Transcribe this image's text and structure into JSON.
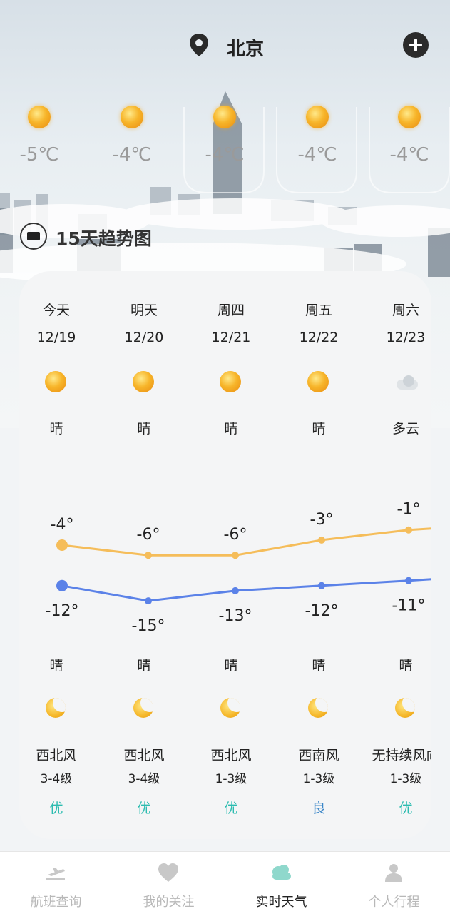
{
  "header": {
    "city": "北京",
    "location_icon": "map-pin-icon",
    "add_icon": "plus-icon"
  },
  "hourly": [
    {
      "icon": "sun-icon",
      "temp": "-5℃"
    },
    {
      "icon": "sun-icon",
      "temp": "-4℃"
    },
    {
      "icon": "sun-icon",
      "temp": "-4℃"
    },
    {
      "icon": "sun-icon",
      "temp": "-4℃"
    },
    {
      "icon": "sun-icon",
      "temp": "-4℃"
    }
  ],
  "trend": {
    "title": "15天趋势图",
    "icon": "briefcase-icon"
  },
  "forecast": [
    {
      "day": "今天",
      "date": "12/19",
      "day_icon": "sun-icon",
      "day_cond": "晴",
      "high": -4,
      "low": -12,
      "high_label": "-4°",
      "low_label": "-12°",
      "night_cond": "晴",
      "night_icon": "moon-icon",
      "wind_dir": "西北风",
      "wind_level": "3-4级",
      "aqi": "优",
      "aqi_color": "#2cbcb0"
    },
    {
      "day": "明天",
      "date": "12/20",
      "day_icon": "sun-icon",
      "day_cond": "晴",
      "high": -6,
      "low": -15,
      "high_label": "-6°",
      "low_label": "-15°",
      "night_cond": "晴",
      "night_icon": "moon-icon",
      "wind_dir": "西北风",
      "wind_level": "3-4级",
      "aqi": "优",
      "aqi_color": "#2cbcb0"
    },
    {
      "day": "周四",
      "date": "12/21",
      "day_icon": "sun-icon",
      "day_cond": "晴",
      "high": -6,
      "low": -13,
      "high_label": "-6°",
      "low_label": "-13°",
      "night_cond": "晴",
      "night_icon": "moon-icon",
      "wind_dir": "西北风",
      "wind_level": "1-3级",
      "aqi": "优",
      "aqi_color": "#2cbcb0"
    },
    {
      "day": "周五",
      "date": "12/22",
      "day_icon": "sun-icon",
      "day_cond": "晴",
      "high": -3,
      "low": -12,
      "high_label": "-3°",
      "low_label": "-12°",
      "night_cond": "晴",
      "night_icon": "moon-icon",
      "wind_dir": "西南风",
      "wind_level": "1-3级",
      "aqi": "良",
      "aqi_color": "#3a86c8"
    },
    {
      "day": "周六",
      "date": "12/23",
      "day_icon": "cloud-icon",
      "day_cond": "多云",
      "high": -1,
      "low": -11,
      "high_label": "-1°",
      "low_label": "-11°",
      "night_cond": "晴",
      "night_icon": "moon-icon",
      "wind_dir": "无持续风向",
      "wind_level": "1-3级",
      "aqi": "优",
      "aqi_color": "#2cbcb0"
    }
  ],
  "colors": {
    "high_line": "#f5bd5a",
    "low_line": "#5b82e8"
  },
  "tabs": [
    {
      "label": "航班查询",
      "icon": "plane-icon",
      "active": false
    },
    {
      "label": "我的关注",
      "icon": "heart-icon",
      "active": false
    },
    {
      "label": "实时天气",
      "icon": "cloud-icon",
      "active": true
    },
    {
      "label": "个人行程",
      "icon": "user-icon",
      "active": false
    }
  ]
}
